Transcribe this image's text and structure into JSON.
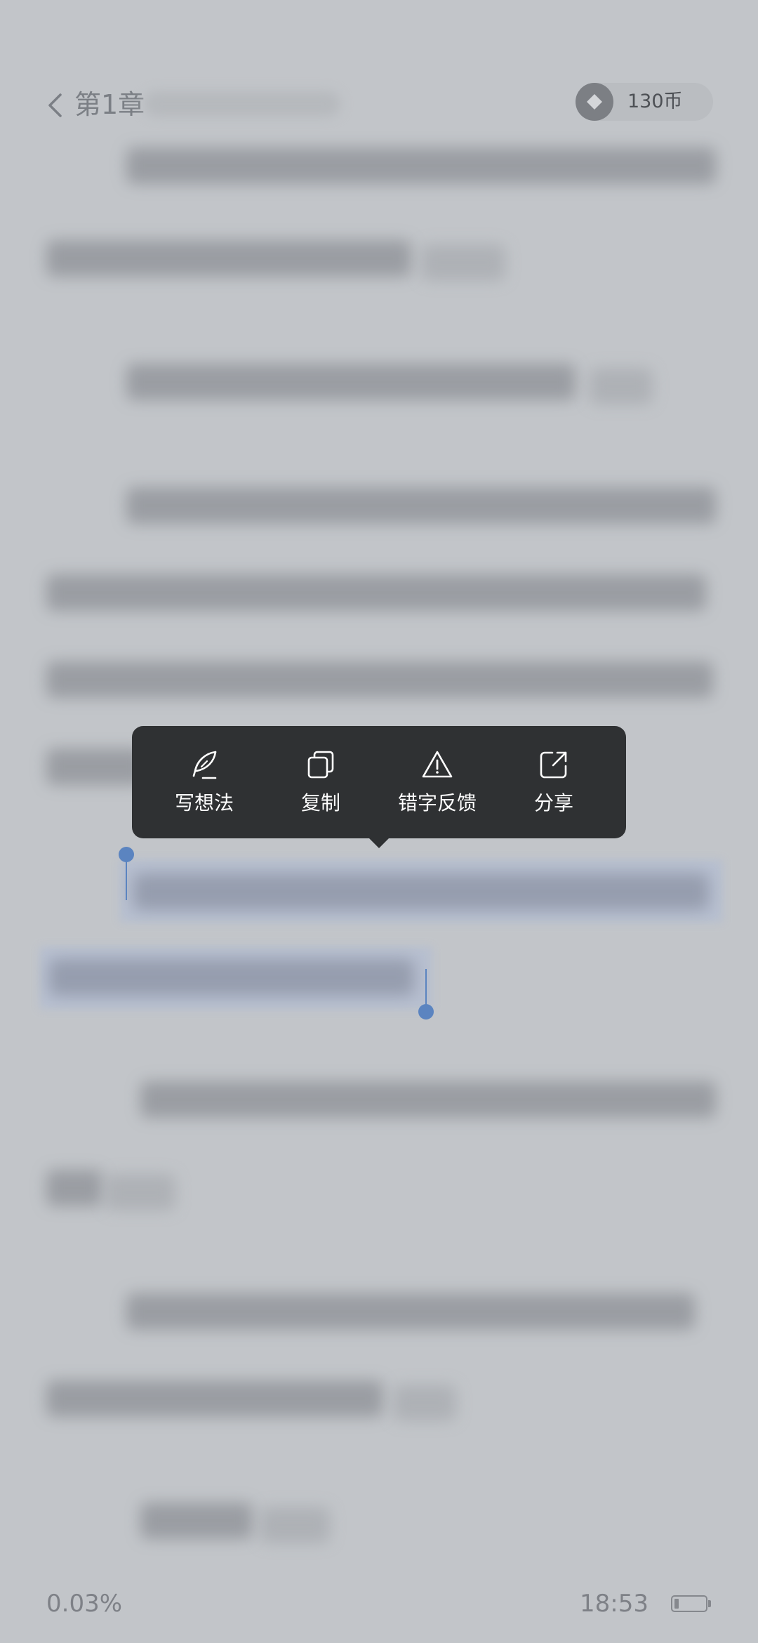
{
  "header": {
    "chapter_title": "第1章",
    "coin_balance": "130币",
    "icons": {
      "back": "chevron-left-icon",
      "coin": "coin-icon"
    }
  },
  "context_menu": {
    "items": [
      {
        "label": "写想法",
        "icon": "feather-pen-icon"
      },
      {
        "label": "复制",
        "icon": "copy-icon"
      },
      {
        "label": "错字反馈",
        "icon": "warning-triangle-icon"
      },
      {
        "label": "分享",
        "icon": "share-arrow-icon"
      }
    ]
  },
  "selection": {
    "handle_color": "#5b84c0"
  },
  "footer": {
    "progress": "0.03%",
    "time": "18:53",
    "battery_icon": "battery-icon"
  },
  "colors": {
    "background": "#c2c5c9",
    "menu_background": "#2f3133",
    "menu_text": "#ffffff"
  }
}
